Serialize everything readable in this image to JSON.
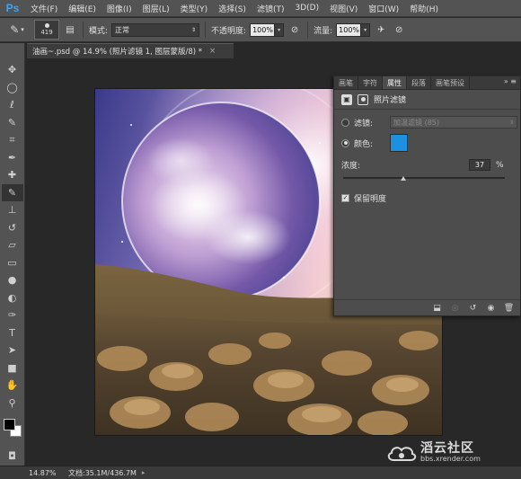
{
  "app": {
    "logo": "Ps"
  },
  "menu": [
    {
      "label": "文件(F)"
    },
    {
      "label": "编辑(E)"
    },
    {
      "label": "图像(I)"
    },
    {
      "label": "图层(L)"
    },
    {
      "label": "类型(Y)"
    },
    {
      "label": "选择(S)"
    },
    {
      "label": "滤镜(T)"
    },
    {
      "label": "3D(D)"
    },
    {
      "label": "视图(V)"
    },
    {
      "label": "窗口(W)"
    },
    {
      "label": "帮助(H)"
    }
  ],
  "options": {
    "brush_size": "419",
    "mode_label": "模式:",
    "mode_value": "正常",
    "opacity_label": "不透明度:",
    "opacity_value": "100%",
    "flow_label": "流量:",
    "flow_value": "100%"
  },
  "document": {
    "tab_title": "油画~.psd @ 14.9% (照片滤镜 1, 图层蒙版/8) *",
    "close_glyph": "×"
  },
  "tools": [
    {
      "icon": "move-icon",
      "glyph": "✥"
    },
    {
      "icon": "marquee-icon",
      "glyph": "◯"
    },
    {
      "icon": "lasso-icon",
      "glyph": "ℓ"
    },
    {
      "icon": "quick-select-icon",
      "glyph": "✎"
    },
    {
      "icon": "crop-icon",
      "glyph": "⌗"
    },
    {
      "icon": "eyedropper-icon",
      "glyph": "✒"
    },
    {
      "icon": "healing-brush-icon",
      "glyph": "✚"
    },
    {
      "icon": "brush-icon",
      "glyph": "✎"
    },
    {
      "icon": "clone-stamp-icon",
      "glyph": "⊥"
    },
    {
      "icon": "history-brush-icon",
      "glyph": "↺"
    },
    {
      "icon": "eraser-icon",
      "glyph": "▱"
    },
    {
      "icon": "gradient-icon",
      "glyph": "▭"
    },
    {
      "icon": "blur-icon",
      "glyph": "●"
    },
    {
      "icon": "dodge-icon",
      "glyph": "◐"
    },
    {
      "icon": "pen-icon",
      "glyph": "✑"
    },
    {
      "icon": "type-icon",
      "glyph": "T"
    },
    {
      "icon": "path-select-icon",
      "glyph": "➤"
    },
    {
      "icon": "shape-icon",
      "glyph": "■"
    },
    {
      "icon": "hand-icon",
      "glyph": "✋"
    },
    {
      "icon": "zoom-icon",
      "glyph": "⚲"
    }
  ],
  "colors": {
    "foreground": "#000000",
    "background": "#ffffff",
    "filter_swatch": "#1e90e0"
  },
  "panel": {
    "tabs": [
      {
        "label": "画笔"
      },
      {
        "label": "字符"
      },
      {
        "label": "属性"
      },
      {
        "label": "段落"
      },
      {
        "label": "画笔预设"
      }
    ],
    "active_tab": 2,
    "title": "照片滤镜",
    "filter_label": "滤镜:",
    "filter_value": "加温滤镜 (85)",
    "color_label": "颜色:",
    "density_label": "浓度:",
    "density_value": "37",
    "density_unit": "%",
    "density_percent": 37,
    "preserve_label": "保留明度",
    "preserve_checked": true
  },
  "status": {
    "zoom": "14.87%",
    "doc_info": "文档:35.1M/436.7M"
  },
  "watermark": {
    "main": "滔云社区",
    "url": "bbs.xrender.com"
  }
}
